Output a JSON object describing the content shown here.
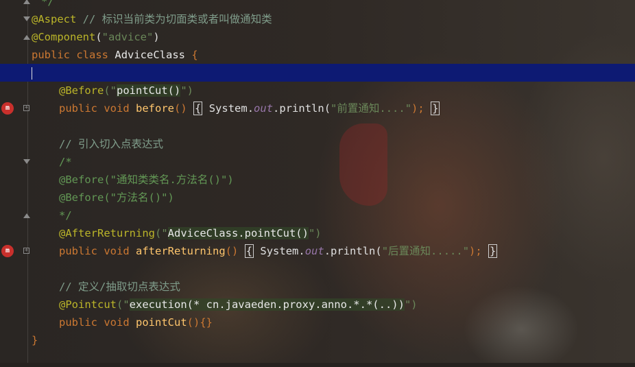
{
  "editor": {
    "lines": {
      "l0": "*/",
      "l1_ann": "@Aspect",
      "l1_cmt": "// 标识当前类为切面类或者叫做通知类",
      "l2_ann": "@Component",
      "l2_open": "(",
      "l2_str": "\"advice\"",
      "l2_close": ")",
      "l3_kw1": "public",
      "l3_kw2": "class",
      "l3_cls": "AdviceClass",
      "l3_brace": "{",
      "l5_ann": "@Before",
      "l5_str1": "(\"",
      "l5_strhl": "pointCut()",
      "l5_str2": "\")",
      "l6_kw1": "public",
      "l6_kw2": "void",
      "l6_fn": "before",
      "l6_paren": "()",
      "l6_lb": "{",
      "l6_sys": "System.",
      "l6_out": "out",
      "l6_println": ".println(",
      "l6_str": "\"前置通知....\"",
      "l6_end": ");",
      "l6_rb": "}",
      "l8_cmt": "// 引入切入点表达式",
      "l9": "/*",
      "l10_ann": "@Before",
      "l10_rest": "(\"通知类类名.方法名()\")",
      "l11_ann": "@Before",
      "l11_rest": "(\"方法名()\")",
      "l12": "*/",
      "l13_ann": "@AfterReturning",
      "l13_str1": "(\"",
      "l13_strhl": "AdviceClass.pointCut()",
      "l13_str2": "\")",
      "l14_kw1": "public",
      "l14_kw2": "void",
      "l14_fn": "afterReturning",
      "l14_paren": "()",
      "l14_lb": "{",
      "l14_sys": "System.",
      "l14_out": "out",
      "l14_println": ".println(",
      "l14_str": "\"后置通知.....\"",
      "l14_end": ");",
      "l14_rb": "}",
      "l16_cmt": "// 定义/抽取切点表达式",
      "l17_ann": "@Pointcut",
      "l17_str1": "(\"",
      "l17_strhl": "execution(* cn.javaeden.proxy.anno.*.*(..))",
      "l17_str2": "\")",
      "l18_kw1": "public",
      "l18_kw2": "void",
      "l18_fn": "pointCut",
      "l18_rest": "(){}",
      "l19": "}"
    },
    "gutter_icons": {
      "aop_before": "m",
      "aop_after": "m"
    }
  },
  "colors": {
    "keyword": "#cc7832",
    "annotation": "#bbb529",
    "string": "#6a8759",
    "method": "#ffc66d",
    "current_line": "#0d1a73"
  }
}
